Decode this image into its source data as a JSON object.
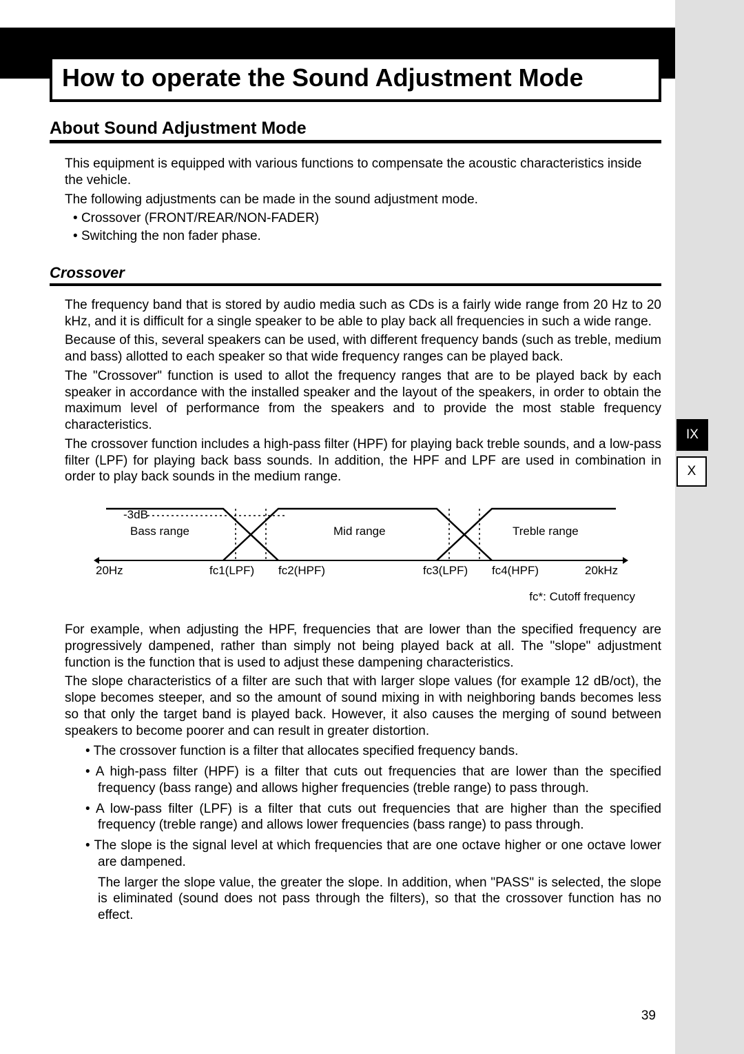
{
  "header": {
    "right_label": "How to operate the Sound Adjustment Mode",
    "title": "How to operate the Sound Adjustment Mode"
  },
  "section1": {
    "heading": "About Sound Adjustment Mode",
    "p1": "This equipment is equipped with various functions to compensate the acoustic characteristics inside the vehicle.",
    "p2": "The following adjustments can be made in the sound adjustment mode.",
    "b1": "Crossover (FRONT/REAR/NON-FADER)",
    "b2": "Switching the non fader phase."
  },
  "section2": {
    "heading": "Crossover",
    "p1": "The frequency band that is stored by audio media such as CDs is a fairly wide range from 20 Hz to 20 kHz, and it is difficult for a single speaker to be able to play back all frequencies in such a wide range.",
    "p2": "Because of this, several speakers can be used, with different frequency bands (such as treble, medium and bass) allotted to each speaker so that wide frequency ranges can be played back.",
    "p3": "The \"Crossover\" function is used to allot the frequency ranges that are to be played back by each speaker in accordance with the installed speaker and the layout of the speakers, in order to obtain the maximum level of performance from the speakers and to provide the most stable frequency characteristics.",
    "p4": "The crossover function includes a high-pass filter (HPF) for playing back treble sounds, and a low-pass filter (LPF) for playing back bass sounds. In addition, the HPF and LPF are used in combination in order to play back sounds in the medium range."
  },
  "diagram": {
    "neg3db": "-3dB",
    "bass": "Bass range",
    "mid": "Mid range",
    "treble": "Treble range",
    "hz20": "20Hz",
    "khz20": "20kHz",
    "fc1": "fc1(LPF)",
    "fc2": "fc2(HPF)",
    "fc3": "fc3(LPF)",
    "fc4": "fc4(HPF)",
    "fc_note": "fc*: Cutoff frequency"
  },
  "section3": {
    "p1": "For example, when adjusting the HPF, frequencies that are lower than the specified frequency are progressively dampened, rather than simply not being played back at all. The \"slope\" adjustment function is the function that is used to adjust these dampening characteristics.",
    "p2": "The slope characteristics of a filter are such that with larger slope values (for example 12 dB/oct), the slope becomes steeper, and so the amount of sound mixing in with neighboring bands becomes less so that only the target band is played back. However, it also causes the merging of sound between speakers to become poorer and can result in greater distortion.",
    "b1": "The crossover function is a filter that allocates specified frequency bands.",
    "b2": "A high-pass filter (HPF) is a filter that cuts out frequencies that are lower than the specified frequency (bass range) and allows higher frequencies (treble range) to pass through.",
    "b3": "A low-pass filter (LPF) is a filter that cuts out frequencies that are higher than the specified frequency (treble range) and allows lower frequencies (bass range) to pass through.",
    "b4": "The slope is the signal level at which frequencies that are one octave higher or one octave lower are dampened.",
    "b4b": "The larger the slope value, the greater the slope. In addition, when \"PASS\" is selected, the slope is eliminated (sound does not pass through the filters), so that the crossover function has no effect."
  },
  "sidetabs": {
    "ix": "IX",
    "x": "X"
  },
  "page_number": "39"
}
